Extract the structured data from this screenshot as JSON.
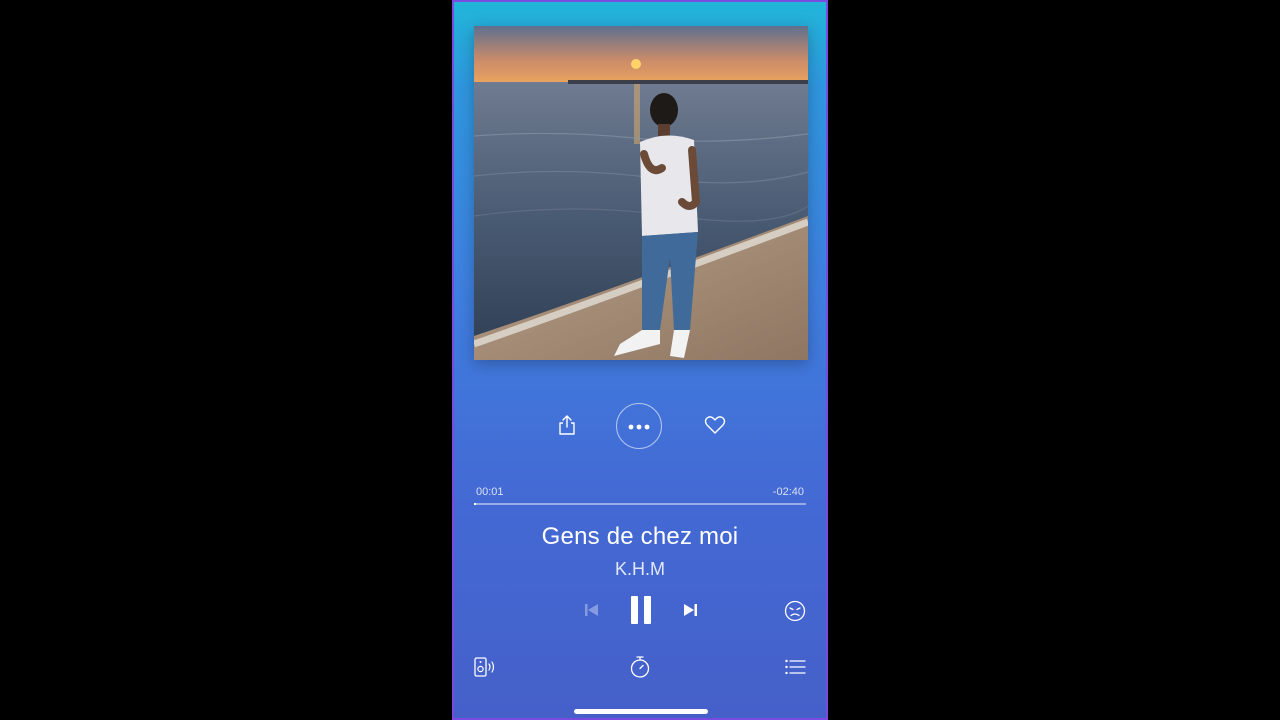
{
  "album_art": {
    "description_icon": "album-cover-image"
  },
  "actions": {
    "share_icon": "share-icon",
    "more_icon": "more-options-icon",
    "like_icon": "heart-icon"
  },
  "player": {
    "elapsed": "00:01",
    "remaining": "-02:40",
    "progress": 0.006,
    "title": "Gens de chez moi",
    "artist": "K.H.M"
  },
  "controls": {
    "previous_icon": "previous-track-icon",
    "pause_icon": "pause-icon",
    "next_icon": "next-track-icon",
    "mood_icon": "emoji-face-icon",
    "speaker_icon": "speaker-icon",
    "timer_icon": "sleep-timer-icon",
    "queue_icon": "queue-list-icon"
  },
  "colors": {
    "accent": "#ffffff",
    "background_top": "#21b6d8",
    "background_bottom": "#4560c9"
  }
}
